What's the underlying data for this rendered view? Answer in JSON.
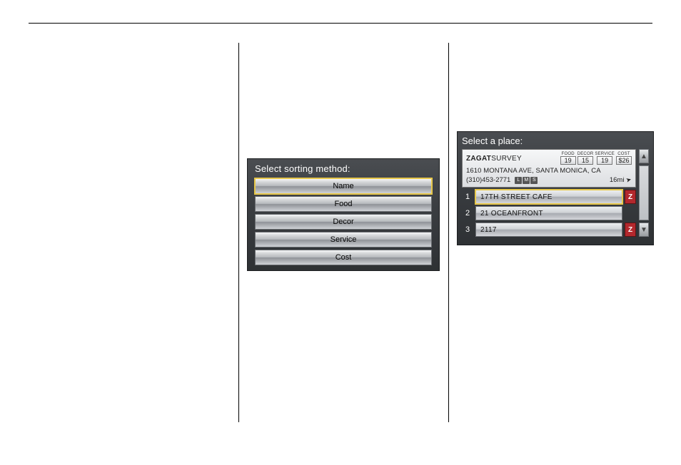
{
  "sort_panel": {
    "title": "Select sorting method:",
    "options": [
      {
        "label": "Name",
        "selected": true
      },
      {
        "label": "Food",
        "selected": false
      },
      {
        "label": "Decor",
        "selected": false
      },
      {
        "label": "Service",
        "selected": false
      },
      {
        "label": "Cost",
        "selected": false
      }
    ]
  },
  "place_panel": {
    "title": "Select a place:",
    "logo_prefix": "ZAGAT",
    "logo_suffix": "SURVEY",
    "ratings": [
      {
        "label": "FOOD",
        "value": "19"
      },
      {
        "label": "DECOR",
        "value": "15"
      },
      {
        "label": "SERVICE",
        "value": "19"
      },
      {
        "label": "COST",
        "value": "$26"
      }
    ],
    "address": "1610 MONTANA AVE, SANTA MONICA, CA",
    "phone": "(310)453-2771",
    "lms": [
      "L",
      "M",
      "S"
    ],
    "distance": "16mi",
    "results": [
      {
        "num": "1",
        "name": "17TH STREET CAFE",
        "z": true,
        "selected": true
      },
      {
        "num": "2",
        "name": "21 OCEANFRONT",
        "z": false,
        "selected": false
      },
      {
        "num": "3",
        "name": "2117",
        "z": true,
        "selected": false
      }
    ],
    "scroll_up": "▲",
    "scroll_down": "▼"
  }
}
